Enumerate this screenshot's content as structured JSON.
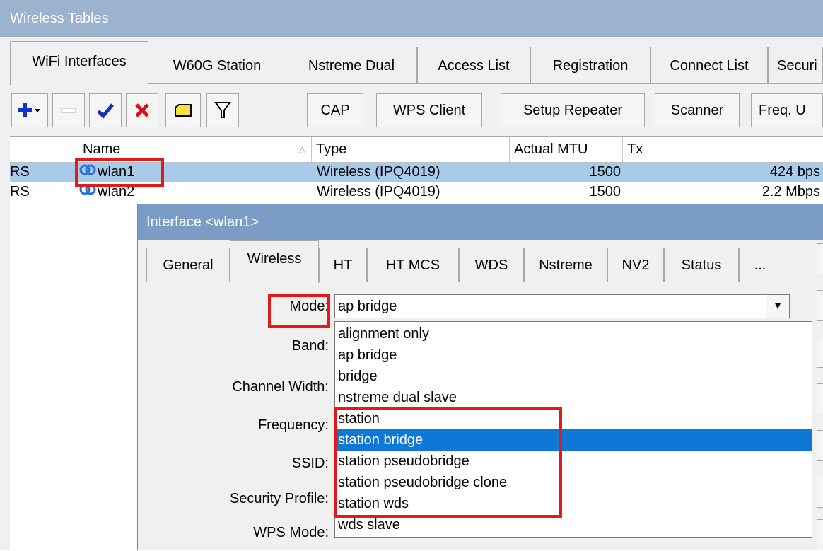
{
  "window": {
    "title": "Wireless Tables"
  },
  "tabs": [
    {
      "label": "WiFi Interfaces"
    },
    {
      "label": "W60G Station"
    },
    {
      "label": "Nstreme Dual"
    },
    {
      "label": "Access List"
    },
    {
      "label": "Registration"
    },
    {
      "label": "Connect List"
    },
    {
      "label": "Securi"
    }
  ],
  "toolbar": {
    "icons": [
      "plus-dropdown-icon",
      "minus-icon",
      "check-icon",
      "x-icon",
      "comment-icon",
      "filter-icon"
    ],
    "buttons": [
      "CAP",
      "WPS Client",
      "Setup Repeater",
      "Scanner",
      "Freq. U"
    ]
  },
  "table": {
    "columns": [
      "Name",
      "Type",
      "Actual MTU",
      "Tx"
    ],
    "rows": [
      {
        "flags": "RS",
        "name": "wlan1",
        "type": "Wireless (IPQ4019)",
        "mtu": "1500",
        "tx": "424 bps"
      },
      {
        "flags": "RS",
        "name": "wlan2",
        "type": "Wireless (IPQ4019)",
        "mtu": "1500",
        "tx": "2.2 Mbps"
      }
    ]
  },
  "dialog": {
    "title": "Interface <wlan1>",
    "tabs": [
      "General",
      "Wireless",
      "HT",
      "HT MCS",
      "WDS",
      "Nstreme",
      "NV2",
      "Status",
      "..."
    ],
    "fields": {
      "mode": "Mode:",
      "band": "Band:",
      "channel_width": "Channel Width:",
      "frequency": "Frequency:",
      "ssid": "SSID:",
      "security_profile": "Security Profile:",
      "wps_mode": "WPS Mode:"
    },
    "mode_value": "ap bridge",
    "mode_options": [
      "alignment only",
      "ap bridge",
      "bridge",
      "nstreme dual slave",
      "station",
      "station bridge",
      "station pseudobridge",
      "station pseudobridge clone",
      "station wds",
      "wds slave"
    ],
    "highlighted_option": "station bridge"
  },
  "colors": {
    "accent": "#0f78d7",
    "highlight": "#e11b1b",
    "titlebar": "#9cb3cf",
    "selected_row": "#a9cbea"
  }
}
